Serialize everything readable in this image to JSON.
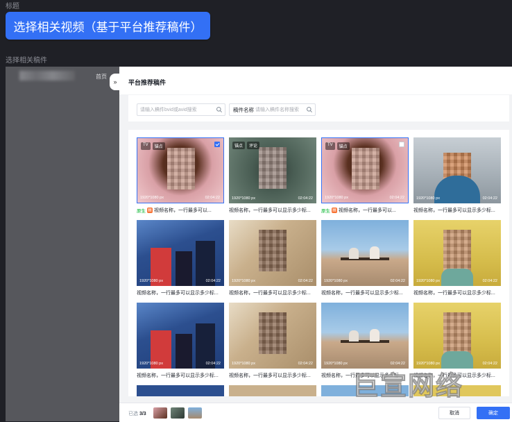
{
  "header": {
    "title_label": "标题",
    "primary_button": "选择相关视频（基于平台推荐稿件）",
    "section_label": "选择相关稿件"
  },
  "left_panel": {
    "link": "首页"
  },
  "drawer": {
    "toggle_icon": "»",
    "title": "平台推荐稿件",
    "search": {
      "placeholder": "请输入稿件bvid或avid搜索"
    },
    "name_filter": {
      "label": "稿件名称",
      "placeholder": "请输入稿件名称搜索"
    }
  },
  "grid": {
    "items": [
      {
        "resolution": "1920*1080 px",
        "duration": "02:04:22",
        "tags": [
          "TV",
          "锚点"
        ],
        "checkbox": "checked",
        "original": "原生",
        "content_icon": "orange-doc-icon",
        "caption": "视频名称，一行最多可以..."
      },
      {
        "resolution": "1920*1080 px",
        "duration": "02:04:22",
        "tags": [
          "锚点",
          "评论"
        ],
        "caption": "视频名称，一行最多可以显示多少标..."
      },
      {
        "resolution": "1920*1080 px",
        "duration": "02:04:22",
        "tags": [
          "TV",
          "锚点"
        ],
        "checkbox": "unchecked",
        "original": "原生",
        "content_icon": "orange-doc-icon",
        "caption": "视频名称，一行最多可以..."
      },
      {
        "resolution": "1920*1080 px",
        "duration": "02:04:22",
        "caption": "视频名称，一行最多可以显示多少标..."
      },
      {
        "resolution": "1920*1080 px",
        "duration": "02:04:22",
        "caption": "视频名称，一行最多可以显示多少标..."
      },
      {
        "resolution": "1920*1080 px",
        "duration": "02:04:22",
        "caption": "视频名称，一行最多可以显示多少标..."
      },
      {
        "resolution": "1920*1080 px",
        "duration": "02:04:22",
        "caption": "视频名称，一行最多可以显示多少标..."
      },
      {
        "resolution": "1920*1080 px",
        "duration": "02:04:22",
        "caption": "视频名称，一行最多可以显示多少标..."
      },
      {
        "resolution": "1920*1080 px",
        "duration": "02:04:22",
        "caption": "视频名称，一行最多可以显示多少标..."
      },
      {
        "resolution": "1920*1080 px",
        "duration": "02:04:22",
        "caption": "视频名称，一行最多可以显示多少标..."
      },
      {
        "resolution": "1920*1080 px",
        "duration": "02:04:22",
        "caption": "视频名称，一行最多可以显示多少标..."
      },
      {
        "resolution": "1920*1080 px",
        "duration": "02:04:22",
        "caption": "视频名称，一行最多可以显示多少标..."
      }
    ]
  },
  "footer": {
    "selected_prefix": "已选",
    "selected_count": "3/3",
    "cancel": "取消",
    "confirm": "确定"
  },
  "watermark": "巨宣网络",
  "colors": {
    "accent": "#3370f5",
    "original_green": "#00b42a",
    "doc_orange": "#f77234"
  }
}
